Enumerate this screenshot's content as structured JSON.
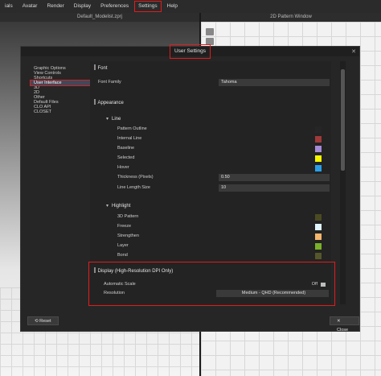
{
  "menubar": [
    "ials",
    "Avatar",
    "Render",
    "Display",
    "Preferences",
    "Settings",
    "Help"
  ],
  "panels": {
    "left_title": "Default_Modelist.zprj",
    "right_title": "2D Pattern Window"
  },
  "dialog": {
    "title": "User Settings",
    "close_glyph": "✕",
    "nav": [
      "Graphic Options",
      "View Controls",
      "Shortcuts",
      "User Interface",
      "3D",
      "2D",
      "Other",
      "Default Files",
      "CLO API",
      "CLOSET"
    ],
    "font_section": "Font",
    "font_family_label": "Font Family",
    "font_family_value": "Tahoma",
    "appearance_section": "Appearance",
    "line_heading": "Line",
    "line_rows": [
      {
        "label": "Pattern Outline",
        "color": "#262626"
      },
      {
        "label": "Internal Line",
        "color": "#a03a3a"
      },
      {
        "label": "Baseline",
        "color": "#a58bd8"
      },
      {
        "label": "Selected",
        "color": "#f5f500"
      },
      {
        "label": "Hover",
        "color": "#2a9fe8"
      }
    ],
    "thickness_label": "Thickness (Pixels)",
    "thickness_value": "0.50",
    "length_label": "Line Length Size",
    "length_value": "10",
    "highlight_heading": "Highlight",
    "highlight_rows": [
      {
        "label": "3D Pattern",
        "color": "#4b4b22"
      },
      {
        "label": "Freeze",
        "color": "#dff7fb"
      },
      {
        "label": "Strengthen",
        "color": "#f5b66e"
      },
      {
        "label": "Layer",
        "color": "#7bb02a"
      },
      {
        "label": "Bond",
        "color": "#55562b"
      }
    ],
    "display_section": "Display (High-Resolution DPI Only)",
    "auto_scale_label": "Automatic Scale",
    "auto_scale_value": "Off",
    "resolution_label": "Resolution",
    "resolution_value": "Medium - QHD (Recommended)",
    "reset_label": "Reset",
    "close_label": "Close"
  }
}
